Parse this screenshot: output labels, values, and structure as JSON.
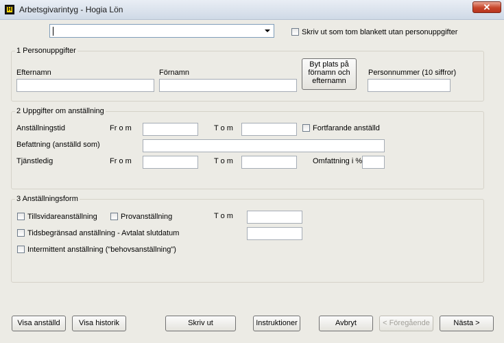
{
  "window": {
    "title": "Arbetsgivarintyg - Hogia Lön",
    "close_glyph": "✕",
    "app_icon_letter": "H"
  },
  "top": {
    "combo_value": "",
    "blank_checkbox_label": "Skriv ut som tom blankett utan personuppgifter"
  },
  "section1": {
    "title": "1 Personuppgifter",
    "efternamn_label": "Efternamn",
    "fornamn_label": "Förnamn",
    "swap_button": [
      "Byt plats på",
      "förnamn och",
      "efternamn"
    ],
    "personnummer_label": "Personnummer (10 siffror)"
  },
  "section2": {
    "title": "2 Uppgifter om anställning",
    "anstallningstid_label": "Anställningstid",
    "from_label": "Fr o m",
    "tom_label": "T o m",
    "fortfarande_label": "Fortfarande anställd",
    "befattning_label": "Befattning (anställd som)",
    "tjanstledig_label": "Tjänstledig",
    "from2_label": "Fr o m",
    "tom2_label": "T o m",
    "omfattning_label": "Omfattning i %"
  },
  "section3": {
    "title": "3 Anställningsform",
    "tillsvidare_label": "Tillsvidareanställning",
    "prov_label": "Provanställning",
    "tom_label": "T o m",
    "tidsbegransad_label": "Tidsbegränsad anställning - Avtalat slutdatum",
    "intermittent_label": "Intermittent anställning (\"behovsanställning\")"
  },
  "buttons": {
    "visa_anstalld": "Visa anställd",
    "visa_historik": "Visa historik",
    "skriv_ut": "Skriv ut",
    "instruktioner": "Instruktioner",
    "avbryt": "Avbryt",
    "foregaende": "< Föregående",
    "nasta": "Nästa >"
  }
}
